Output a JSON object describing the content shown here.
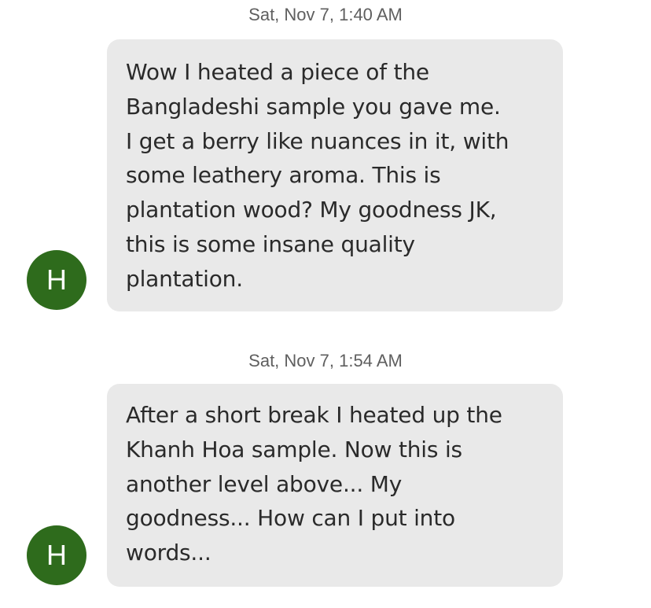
{
  "messages": [
    {
      "timestamp": "Sat, Nov 7, 1:40 AM",
      "avatar_initial": "H",
      "avatar_color": "#2e6b1c",
      "text": "Wow I heated a piece of the\nBangladeshi sample you gave me.\nI get a berry like nuances in it, with\nsome leathery aroma. This is\nplantation wood? My goodness JK,\nthis is some insane quality\nplantation."
    },
    {
      "timestamp": "Sat, Nov 7, 1:54 AM",
      "avatar_initial": "H",
      "avatar_color": "#2e6b1c",
      "text": "After a short break I heated up the\nKhanh Hoa sample. Now this is\nanother level above... My\ngoodness... How can I put into\nwords..."
    }
  ],
  "colors": {
    "bubble_background": "#e9e9e9",
    "timestamp_text": "#5f5f5f",
    "message_text": "#2a2a2a"
  }
}
